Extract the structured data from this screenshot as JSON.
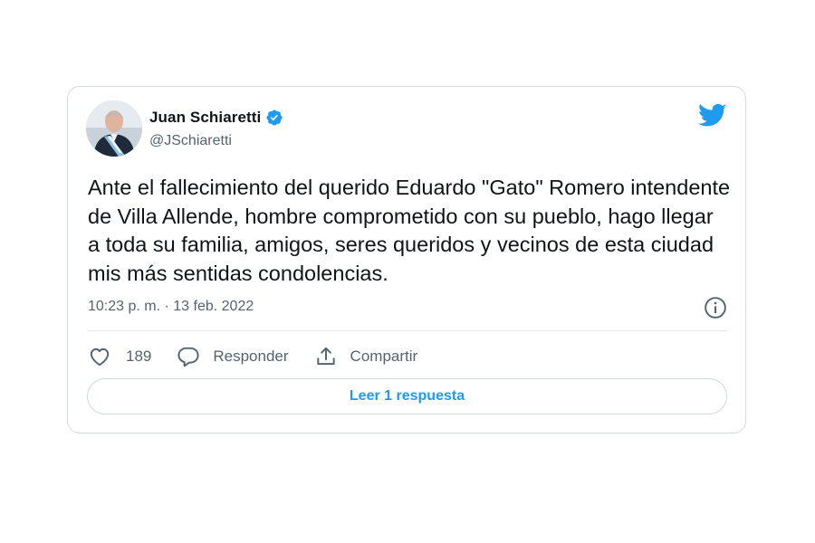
{
  "tweet": {
    "author": {
      "display_name": "Juan Schiaretti",
      "handle": "@JSchiaretti",
      "verified": true
    },
    "text": "Ante el fallecimiento del querido Eduardo \"Gato\" Romero intendente de Villa Allende, hombre comprometido con su pueblo, hago llegar a toda su familia, amigos, seres queridos y vecinos de esta ciudad mis más sentidas condolencias.",
    "timestamp": "10:23 p. m. · 13 feb. 2022",
    "actions": {
      "like_count": "189",
      "reply_label": "Responder",
      "share_label": "Compartir"
    },
    "read_replies_label": "Leer 1 respuesta"
  },
  "icons": {
    "brand": "twitter-bird-icon",
    "verified": "verified-badge-icon",
    "info": "info-icon",
    "like": "heart-icon",
    "reply": "speech-bubble-icon",
    "share": "share-upload-icon"
  },
  "colors": {
    "brand_blue": "#1d9bf0",
    "text_primary": "#0f1419",
    "text_secondary": "#536471",
    "border": "#d3d9de"
  }
}
